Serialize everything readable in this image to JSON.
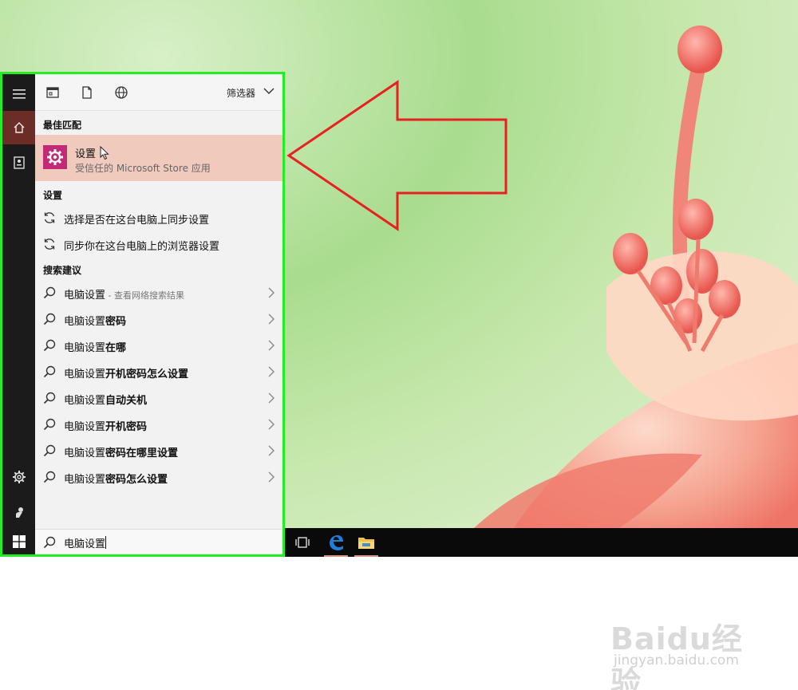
{
  "start_menu": {
    "filter_label": "筛选器",
    "best_match_header": "最佳匹配",
    "best_match": {
      "title": "设置",
      "subtitle": "受信任的 Microsoft Store 应用",
      "icon": "settings-gear-icon",
      "icon_color": "#c22a78"
    },
    "settings_header": "设置",
    "settings_items": [
      {
        "label": "选择是否在这台电脑上同步设置",
        "icon": "sync-icon"
      },
      {
        "label": "同步你在这台电脑上的浏览器设置",
        "icon": "sync-icon"
      }
    ],
    "suggestions_header": "搜索建议",
    "suggestions": [
      {
        "prefix": "电脑设置",
        "bold": "",
        "hint": " - 查看网络搜索结果"
      },
      {
        "prefix": "电脑设置",
        "bold": "密码",
        "hint": ""
      },
      {
        "prefix": "电脑设置",
        "bold": "在哪",
        "hint": ""
      },
      {
        "prefix": "电脑设置",
        "bold": "开机密码怎么设置",
        "hint": ""
      },
      {
        "prefix": "电脑设置",
        "bold": "自动关机",
        "hint": ""
      },
      {
        "prefix": "电脑设置",
        "bold": "开机密码",
        "hint": ""
      },
      {
        "prefix": "电脑设置",
        "bold": "密码在哪里设置",
        "hint": ""
      },
      {
        "prefix": "电脑设置",
        "bold": "密码怎么设置",
        "hint": ""
      }
    ],
    "search_value": "电脑设置"
  },
  "colors": {
    "highlight_border": "#22ee22",
    "arrow": "#e82020",
    "best_match_bg": "#f0cbbd",
    "rail_active": "#6b2d25"
  },
  "watermark": {
    "brand": "Baidu经验",
    "url": "jingyan.baidu.com"
  }
}
